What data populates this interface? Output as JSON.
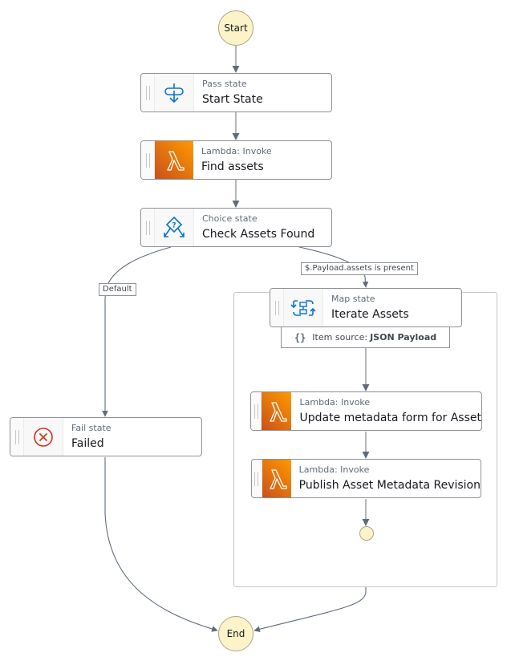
{
  "diagram": {
    "start": {
      "label": "Start"
    },
    "end": {
      "label": "End"
    },
    "states": [
      {
        "id": "start-state",
        "type": "Pass state",
        "name": "Start State",
        "icon": "pass-icon"
      },
      {
        "id": "find-assets",
        "type": "Lambda: Invoke",
        "name": "Find assets",
        "icon": "lambda-icon"
      },
      {
        "id": "check-assets-found",
        "type": "Choice state",
        "name": "Check Assets Found",
        "icon": "choice-icon"
      },
      {
        "id": "iterate-assets",
        "type": "Map state",
        "name": "Iterate Assets",
        "icon": "map-icon"
      },
      {
        "id": "update-metadata-form",
        "type": "Lambda: Invoke",
        "name": "Update metadata form for Asset",
        "icon": "lambda-icon"
      },
      {
        "id": "publish-asset-metadata",
        "type": "Lambda: Invoke",
        "name": "Publish Asset Metadata Revision",
        "icon": "lambda-icon"
      },
      {
        "id": "failed",
        "type": "Fail state",
        "name": "Failed",
        "icon": "fail-icon"
      }
    ],
    "edge_labels": {
      "default": "Default",
      "assets_present": "$.Payload.assets is present"
    },
    "item_source": {
      "prefix": "Item source:",
      "value": "JSON Payload"
    },
    "colors": {
      "terminal_fill": "#fcf4c8",
      "lambda_start": "#c8511b",
      "lambda_end": "#ff9900",
      "icon_blue": "#0972d3",
      "fail_red": "#d13212",
      "edge": "#5f6b7a"
    }
  }
}
